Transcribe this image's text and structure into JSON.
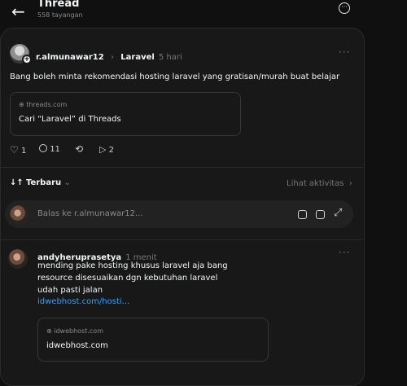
{
  "header": {
    "title": "Thread",
    "views": "558 tayangan"
  },
  "post": {
    "username": "r.almunawar12",
    "topic": "Laravel",
    "time": "5 hari",
    "text": "Bang boleh minta rekomendasi hosting laravel yang gratisan/murah buat belajar",
    "card": {
      "domain": "threads.com",
      "title": "Cari “Laravel” di Threads"
    },
    "actions": {
      "likes": "1",
      "comments": "11",
      "shares": "2"
    }
  },
  "sort": {
    "label": "Terbaru",
    "activity_link": "Lihat aktivitas"
  },
  "reply_input": {
    "placeholder": "Balas ke r.almunawar12..."
  },
  "reply": {
    "username": "andyheruprasetya",
    "time": "1 menit",
    "lines": [
      "mending pake hosting khusus laravel aja bang",
      "resource disesuaikan dgn kebutuhan laravel",
      "udah pasti jalan"
    ],
    "link": "idwebhost.com/hosti...",
    "card": {
      "domain": "idwebhost.com",
      "title": "idwebhost.com"
    }
  }
}
